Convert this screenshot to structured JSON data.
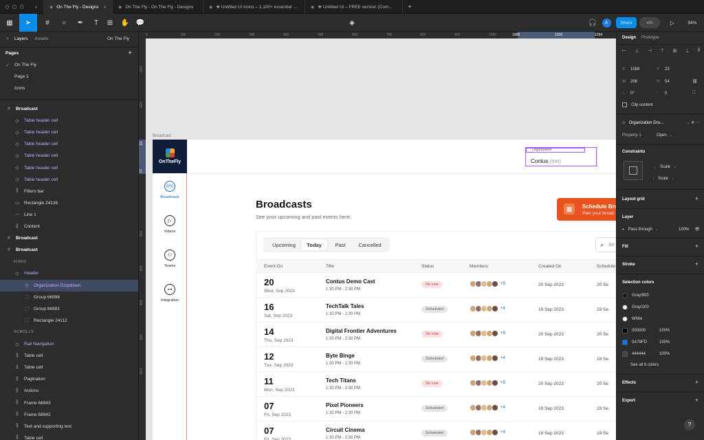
{
  "tabs": [
    {
      "label": "On The Fly - Designs",
      "active": true
    },
    {
      "label": "On The Fly - On The Fly - Designs"
    },
    {
      "label": "❖ Untitled UI Icons – 1,100+ essential Fig"
    },
    {
      "label": "❖ Untitled UI – FREE version (Community)"
    }
  ],
  "toolbar": {
    "share_label": "Share",
    "zoom": "94%",
    "avatar": "A"
  },
  "left_panel": {
    "tab_layers": "Layers",
    "tab_assets": "Assets",
    "file_name": "On The Fly",
    "pages_title": "Pages",
    "pages": [
      "On The Fly",
      "Page 1",
      "Icons"
    ],
    "layers": [
      {
        "label": "Broadcast",
        "type": "frame"
      },
      {
        "label": "Table header cell",
        "type": "comp"
      },
      {
        "label": "Table header cell",
        "type": "comp"
      },
      {
        "label": "Table header cell",
        "type": "comp"
      },
      {
        "label": "Table header cell",
        "type": "comp"
      },
      {
        "label": "Table header cell",
        "type": "comp"
      },
      {
        "label": "Table header cell",
        "type": "comp"
      },
      {
        "label": "Filters bar",
        "type": "auto"
      },
      {
        "label": "Rectangle 24136",
        "type": "rect"
      },
      {
        "label": "Line 1",
        "type": "line"
      },
      {
        "label": "Content",
        "type": "auto"
      },
      {
        "label": "Broadcast",
        "type": "frame"
      },
      {
        "label": "Broadcast",
        "type": "frame"
      },
      {
        "label": "FIXED",
        "type": "section"
      },
      {
        "label": "Header",
        "type": "comp"
      },
      {
        "label": "Organization Dropdown",
        "type": "comp-selected"
      },
      {
        "label": "Group 66996",
        "type": "group"
      },
      {
        "label": "Group 66981",
        "type": "group"
      },
      {
        "label": "Rectangle 24112",
        "type": "group"
      },
      {
        "label": "SCROLLS",
        "type": "section"
      },
      {
        "label": "Rail Navigation",
        "type": "comp"
      },
      {
        "label": "Table cell",
        "type": "auto"
      },
      {
        "label": "Table cell",
        "type": "auto"
      },
      {
        "label": "Pagination",
        "type": "auto"
      },
      {
        "label": "Actions",
        "type": "auto"
      },
      {
        "label": "Frame 66943",
        "type": "auto"
      },
      {
        "label": "Frame 66942",
        "type": "auto"
      },
      {
        "label": "Text and supporting text",
        "type": "auto"
      },
      {
        "label": "Table cell",
        "type": "auto"
      },
      {
        "label": "Table cell",
        "type": "auto"
      }
    ]
  },
  "rulers": {
    "top": [
      "0",
      "100",
      "200",
      "300",
      "400",
      "500",
      "600",
      "700",
      "800",
      "900",
      "1000",
      "1088",
      "1200",
      "1294"
    ],
    "left": [
      "-200",
      "-100",
      "23",
      "77",
      "200",
      "300",
      "400",
      "500",
      "600"
    ]
  },
  "canvas": {
    "frame_label": "Broadcast",
    "logo_text": "OnTheFly",
    "org_label": "Organization",
    "org_value": "Contus",
    "org_suffix": "(me)",
    "nav": [
      {
        "label": "Broadcasts",
        "icon": "broadcast-icon",
        "active": true
      },
      {
        "label": "Videos",
        "icon": "play-icon"
      },
      {
        "label": "Teams",
        "icon": "team-icon"
      },
      {
        "label": "Integration",
        "icon": "link-icon"
      }
    ],
    "page_title": "Broadcasts",
    "page_subtitle": "See your upcoming and past events here.",
    "cta_title": "Schedule Bro",
    "cta_sub": "Plan your broad",
    "filters": [
      "Upcoming",
      "Today",
      "Past",
      "Cancelled"
    ],
    "search_placeholder": "Se",
    "columns": [
      "Event On",
      "Title",
      "Status",
      "Members",
      "Created On",
      "Schedule"
    ],
    "rows": [
      {
        "day": "20",
        "date": "Wed, Sep 2023",
        "title": "Contus Demo Cast",
        "time": "1:30 PM - 2:30 PM",
        "status": "On Live",
        "live": true,
        "more": "+5",
        "created": "20 Sep 2023",
        "sched": "20 Se"
      },
      {
        "day": "16",
        "date": "Sat, Sep 2023",
        "title": "TechTalk Tales",
        "time": "1:30 PM - 2:30 PM",
        "status": "Scheduled",
        "live": false,
        "more": "+4",
        "created": "19 Sep 2023",
        "sched": "19 Se"
      },
      {
        "day": "14",
        "date": "Thu, Sep 2023",
        "title": "Digital Frontier Adventures",
        "time": "1:30 PM - 2:30 PM",
        "status": "On Live",
        "live": true,
        "more": "+5",
        "created": "20 Sep 2023",
        "sched": "20 Se"
      },
      {
        "day": "12",
        "date": "Tue, Sep 2023",
        "title": "Byte Binge",
        "time": "1:30 PM - 2:30 PM",
        "status": "Scheduled",
        "live": false,
        "more": "+4",
        "created": "19 Sep 2023",
        "sched": "19 Se"
      },
      {
        "day": "11",
        "date": "Mon, Sep 2023",
        "title": "Tech Titans",
        "time": "1:30 PM - 2:30 PM",
        "status": "On Live",
        "live": true,
        "more": "+5",
        "created": "20 Sep 2023",
        "sched": "20 Se"
      },
      {
        "day": "07",
        "date": "Fri, Sep 2023",
        "title": "Pixel Pioneers",
        "time": "1:30 PM - 2:30 PM",
        "status": "Scheduled",
        "live": false,
        "more": "+4",
        "created": "19 Sep 2023",
        "sched": "19 Se"
      },
      {
        "day": "07",
        "date": "Fri, Sep 2023",
        "title": "Circuit Cinema",
        "time": "1:30 PM - 2:30 PM",
        "status": "Scheduled",
        "live": false,
        "more": "+4",
        "created": "19 Sep 2023",
        "sched": "19 Se"
      }
    ]
  },
  "right_panel": {
    "tab_design": "Design",
    "tab_prototype": "Prototype",
    "x": "1088",
    "y": "23",
    "w": "206",
    "h": "54",
    "rotation": "0°",
    "radius": "0",
    "clip_content": "Clip content",
    "component_name": "Organization Dro...",
    "property_label": "Property 1",
    "property_value": "Open",
    "constraints_title": "Constraints",
    "scale_h": "Scale",
    "scale_v": "Scale",
    "layout_grid": "Layout grid",
    "layer_title": "Layer",
    "blend": "Pass through",
    "opacity": "100%",
    "fill": "Fill",
    "stroke": "Stroke",
    "selection_colors": "Selection colors",
    "colors": [
      {
        "name": "Gray/900",
        "hex": "#101828",
        "pct": ""
      },
      {
        "name": "Gray/100",
        "hex": "#f2f4f7",
        "pct": ""
      },
      {
        "name": "White",
        "hex": "#ffffff",
        "pct": ""
      },
      {
        "name": "000000",
        "hex": "#000000",
        "pct": "100%"
      },
      {
        "name": "0A78FD",
        "hex": "#0a78fd",
        "pct": "100%"
      },
      {
        "name": "444444",
        "hex": "#444444",
        "pct": "100%"
      }
    ],
    "see_all": "See all 6 colors",
    "effects": "Effects",
    "export": "Export",
    "help": "?"
  }
}
